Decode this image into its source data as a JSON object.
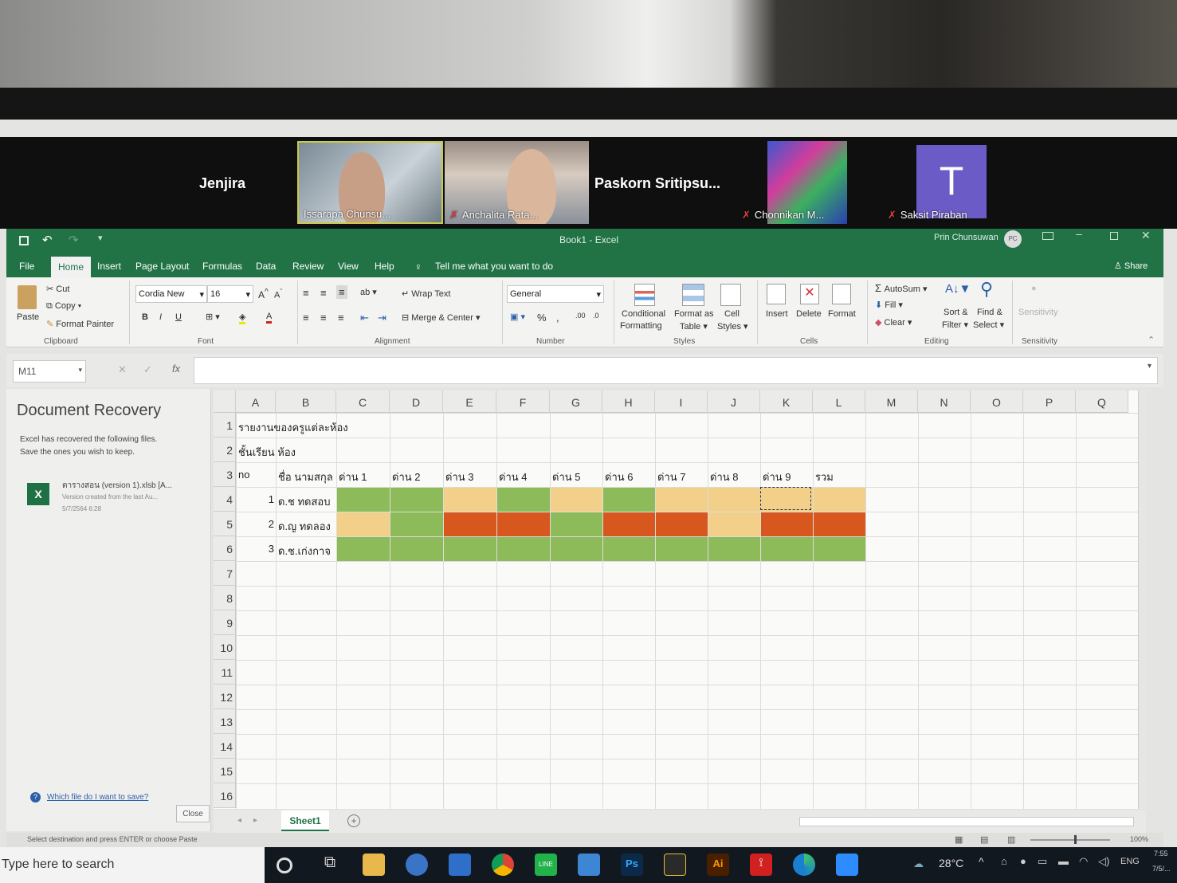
{
  "meeting": {
    "name_jenjira": "Jenjira",
    "tile_issarapa": "Issarapa Chunsu...",
    "tile_anchalita": "Anchalita Rata...",
    "name_paskorn": "Paskorn Sritipsu...",
    "tile_chonnikan": "Chonnikan M...",
    "tile_saksit": "Saksit Piraban",
    "avatar_letter": "T"
  },
  "window": {
    "title": "Book1  -  Excel",
    "user": "Prin Chunsuwan",
    "user_initials": "PC"
  },
  "menu": {
    "file": "File",
    "home": "Home",
    "insert": "Insert",
    "page_layout": "Page Layout",
    "formulas": "Formulas",
    "data": "Data",
    "review": "Review",
    "view": "View",
    "help": "Help",
    "tell_me": "Tell me what you want to do",
    "share": "Share"
  },
  "ribbon": {
    "paste": "Paste",
    "cut": "Cut",
    "copy": "Copy",
    "format_painter": "Format Painter",
    "clipboard": "Clipboard",
    "font_name": "Cordia New",
    "font_size": "16",
    "font": "Font",
    "wrap_text": "Wrap Text",
    "merge_center": "Merge & Center",
    "alignment": "Alignment",
    "number_format": "General",
    "number": "Number",
    "conditional_1": "Conditional",
    "conditional_2": "Formatting",
    "format_as_table_1": "Format as",
    "format_as_table_2": "Table",
    "cell_styles_1": "Cell",
    "cell_styles_2": "Styles",
    "styles": "Styles",
    "insert": "Insert",
    "delete": "Delete",
    "format": "Format",
    "cells": "Cells",
    "autosum": "AutoSum",
    "fill": "Fill",
    "clear": "Clear",
    "sort_filter_1": "Sort &",
    "sort_filter_2": "Filter",
    "find_select_1": "Find &",
    "find_select_2": "Select",
    "editing": "Editing",
    "sensitivity": "Sensitivity",
    "sensitivity_group": "Sensitivity"
  },
  "formula_bar": {
    "name_box": "M11",
    "fx": "fx",
    "value": ""
  },
  "recovery": {
    "title": "Document Recovery",
    "desc_1": "Excel has recovered the following files.",
    "desc_2": "Save the ones you wish to keep.",
    "file_name": "ตารางสอน (version 1).xlsb  [A...",
    "file_note": "Version created from the last Au...",
    "file_date": "5/7/2564 6:28",
    "help_link": "Which file do I want to save?",
    "close": "Close"
  },
  "sheet": {
    "columns": [
      "A",
      "B",
      "C",
      "D",
      "E",
      "F",
      "G",
      "H",
      "I",
      "J",
      "K",
      "L",
      "M",
      "N",
      "O",
      "P",
      "Q"
    ],
    "rows": [
      "1",
      "2",
      "3",
      "4",
      "5",
      "6",
      "7",
      "8",
      "9",
      "10",
      "11",
      "12",
      "13",
      "14",
      "15",
      "16"
    ],
    "r1_title": "รายงานของครูแต่ละห้อง",
    "r2_class": "ชั้นเรียน ห้อง",
    "h_no": "no",
    "h_name": "ชื่อ นามสกุล",
    "h_stages": [
      "ด่าน 1",
      "ด่าน 2",
      "ด่าน 3",
      "ด่าน 4",
      "ด่าน 5",
      "ด่าน 6",
      "ด่าน 7",
      "ด่าน 8",
      "ด่าน 9",
      "รวม"
    ],
    "students": [
      {
        "no": "1",
        "name": "ด.ช ทดสอบ"
      },
      {
        "no": "2",
        "name": "ด.ญ ทดลอง"
      },
      {
        "no": "3",
        "name": "ด.ช.เก่งกาจ"
      }
    ],
    "fill_colors": {
      "green": "#8dbb5a",
      "tan": "#f2d08a",
      "orange": "#d8571f"
    },
    "sheet_tab": "Sheet1",
    "zoom": "100%"
  },
  "status": {
    "message": "Select destination and press ENTER or choose Paste"
  },
  "taskbar": {
    "search": "Type here to search",
    "temperature": "28°C",
    "lang": "ENG",
    "time": "7:55",
    "date": "7/5/..."
  }
}
